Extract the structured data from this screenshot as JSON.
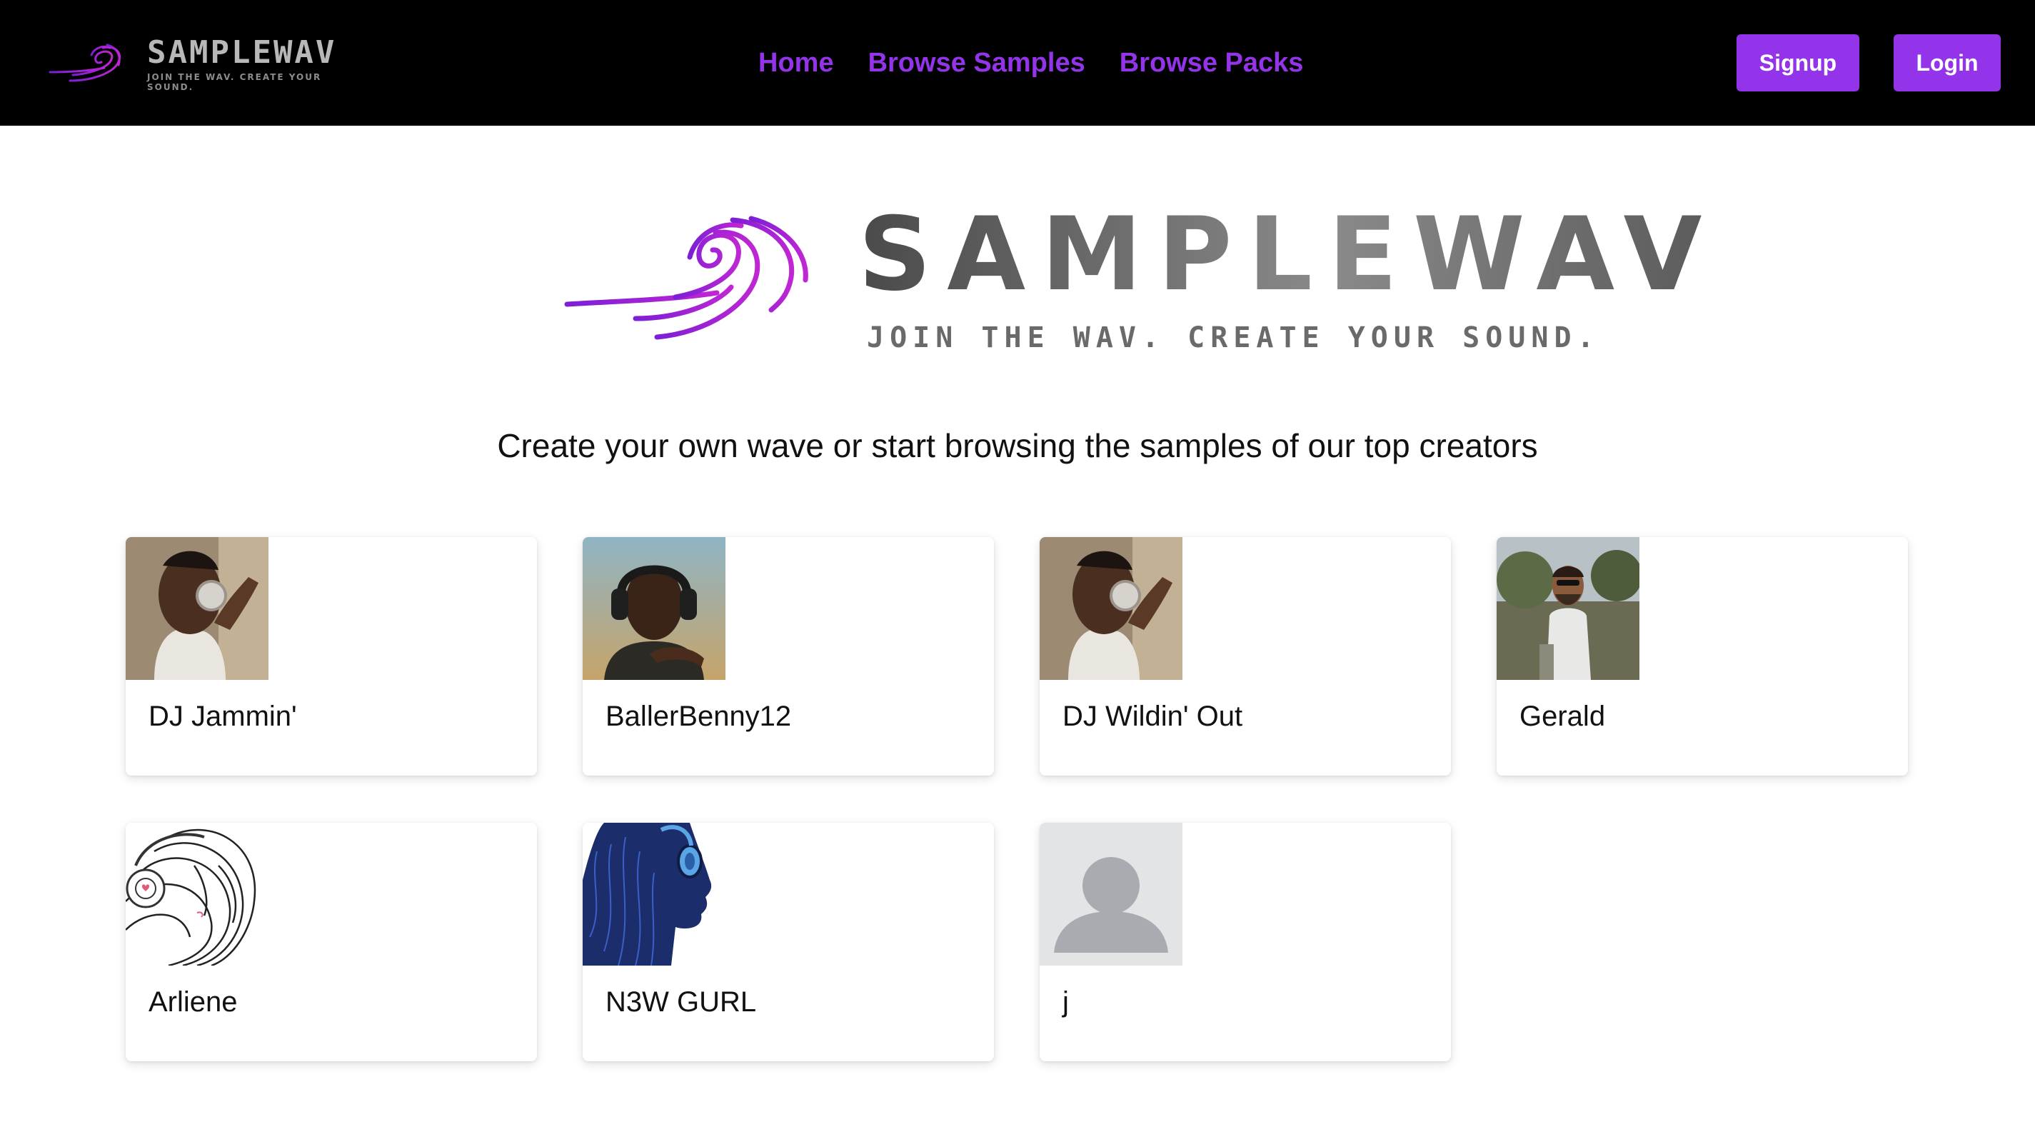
{
  "navbar": {
    "logo": {
      "name": "SAMPLEWAV",
      "tagline": "JOIN THE WAV. CREATE YOUR SOUND."
    },
    "links": [
      {
        "label": "Home"
      },
      {
        "label": "Browse Samples"
      },
      {
        "label": "Browse Packs"
      }
    ],
    "signup_label": "Signup",
    "login_label": "Login"
  },
  "hero": {
    "logo_name": "SAMPLEWAV",
    "logo_tagline": "JOIN THE WAV. CREATE YOUR SOUND.",
    "subtitle": "Create your own wave or start browsing the samples of our top creators"
  },
  "creators": [
    {
      "name": "DJ Jammin'",
      "avatar": "man-with-headphones-photo"
    },
    {
      "name": "BallerBenny12",
      "avatar": "man-with-headphones-photo"
    },
    {
      "name": "DJ Wildin' Out",
      "avatar": "man-with-headphones-photo"
    },
    {
      "name": "Gerald",
      "avatar": "man-outdoors-photo"
    },
    {
      "name": "Arliene",
      "avatar": "sketch-woman-headphones"
    },
    {
      "name": "N3W GURL",
      "avatar": "silhouette-woman-headphones"
    },
    {
      "name": "j",
      "avatar": "default-user-placeholder"
    }
  ],
  "colors": {
    "accent": "#9333ea",
    "navbar_bg": "#000000",
    "page_bg": "#ffffff"
  }
}
